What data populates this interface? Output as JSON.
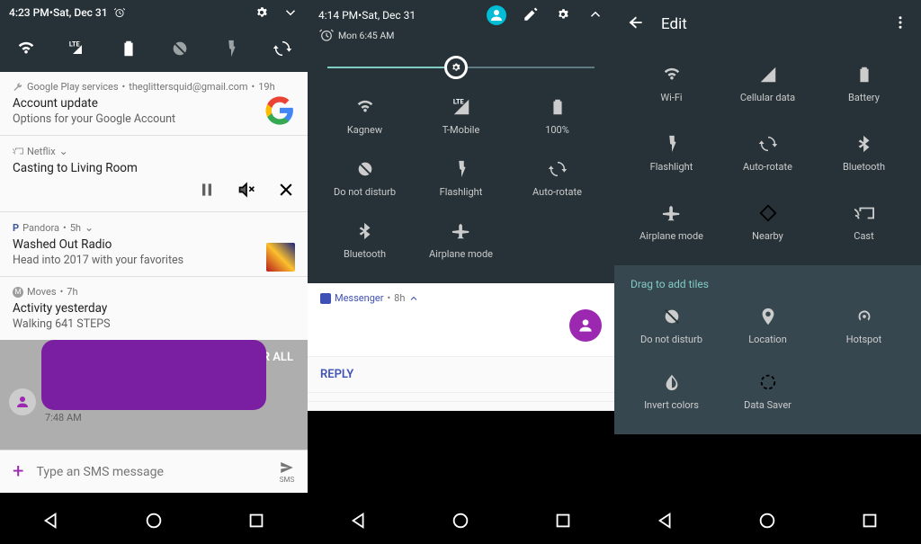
{
  "panel1": {
    "status": {
      "time": "4:23 PM",
      "sep": " • ",
      "date": "Sat, Dec 31"
    },
    "qs_icons": [
      "wifi",
      "lte",
      "battery",
      "dnd",
      "flashlight",
      "rotate"
    ],
    "notifs": [
      {
        "app": "Google Play services",
        "acct": "theglittersquid@gmail.com",
        "age": "19h",
        "title": "Account update",
        "body": "Options for your Google Account",
        "icon": "wrench"
      },
      {
        "app": "Netflix",
        "age": "",
        "title": "Casting to Living Room",
        "body": "",
        "icon": "cast",
        "actions": [
          "pause",
          "mute",
          "close"
        ]
      },
      {
        "app": "Pandora",
        "age": "5h",
        "title": "Washed Out Radio",
        "body": "Head into 2017 with your favorites",
        "icon": "pandora"
      },
      {
        "app": "Moves",
        "age": "7h",
        "title": "Activity yesterday",
        "body": "Walking 641 STEPS",
        "icon": "moves"
      }
    ],
    "clear": "CLEAR ALL",
    "sms": {
      "time": "7:48 AM",
      "placeholder": "Type an SMS message",
      "send": "SMS"
    }
  },
  "panel2": {
    "status": {
      "time": "4:14 PM",
      "sep": " • ",
      "date": "Sat, Dec 31",
      "alarm": "Mon 6:45 AM"
    },
    "brightness_pct": 48,
    "tiles": [
      {
        "icon": "wifi",
        "label": "Kagnew"
      },
      {
        "icon": "lte",
        "label": "T-Mobile"
      },
      {
        "icon": "battery",
        "label": "100%"
      },
      {
        "icon": "dnd",
        "label": "Do not disturb"
      },
      {
        "icon": "flashlight",
        "label": "Flashlight"
      },
      {
        "icon": "rotate",
        "label": "Auto-rotate"
      },
      {
        "icon": "bluetooth",
        "label": "Bluetooth"
      },
      {
        "icon": "airplane",
        "label": "Airplane mode"
      }
    ],
    "msg": {
      "app": "Messenger",
      "age": "8h"
    },
    "reply": "REPLY"
  },
  "panel3": {
    "title": "Edit",
    "tiles": [
      {
        "icon": "wifi",
        "label": "Wi-Fi"
      },
      {
        "icon": "cell",
        "label": "Cellular data"
      },
      {
        "icon": "battery",
        "label": "Battery"
      },
      {
        "icon": "flashlight",
        "label": "Flashlight"
      },
      {
        "icon": "rotate",
        "label": "Auto-rotate"
      },
      {
        "icon": "bluetooth",
        "label": "Bluetooth"
      },
      {
        "icon": "airplane",
        "label": "Airplane mode"
      },
      {
        "icon": "nearby",
        "label": "Nearby"
      },
      {
        "icon": "cast",
        "label": "Cast"
      }
    ],
    "drag_hint": "Drag to add tiles",
    "drag_tiles": [
      {
        "icon": "dnd",
        "label": "Do not disturb"
      },
      {
        "icon": "location",
        "label": "Location"
      },
      {
        "icon": "hotspot",
        "label": "Hotspot"
      },
      {
        "icon": "invert",
        "label": "Invert colors"
      },
      {
        "icon": "datasaver",
        "label": "Data Saver"
      }
    ]
  }
}
